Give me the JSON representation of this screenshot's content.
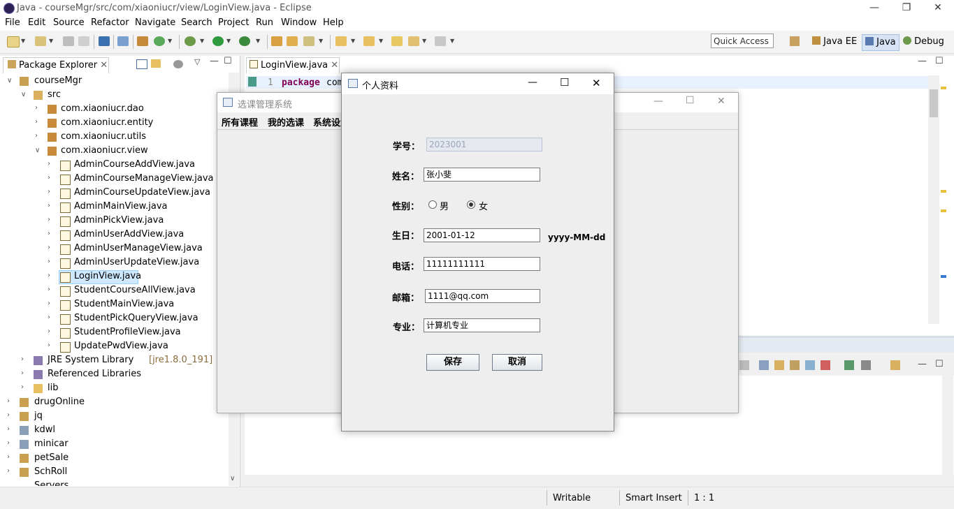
{
  "window": {
    "title": "Java - courseMgr/src/com/xiaoniucr/view/LoginView.java - Eclipse"
  },
  "menu": [
    "File",
    "Edit",
    "Source",
    "Refactor",
    "Navigate",
    "Search",
    "Project",
    "Run",
    "Window",
    "Help"
  ],
  "quick_access": "Quick Access",
  "perspectives": [
    "Java EE",
    "Java",
    "Debug"
  ],
  "package_explorer": {
    "tab": "Package Explorer",
    "project": "courseMgr",
    "src": "src",
    "packages": [
      "com.xiaoniucr.dao",
      "com.xiaoniucr.entity",
      "com.xiaoniucr.utils",
      "com.xiaoniucr.view"
    ],
    "files": [
      "AdminCourseAddView.java",
      "AdminCourseManageView.java",
      "AdminCourseUpdateView.java",
      "AdminMainView.java",
      "AdminPickView.java",
      "AdminUserAddView.java",
      "AdminUserManageView.java",
      "AdminUserUpdateView.java",
      "LoginView.java",
      "StudentCourseAllView.java",
      "StudentMainView.java",
      "StudentPickQueryView.java",
      "StudentProfileView.java",
      "UpdatePwdView.java"
    ],
    "jre": "JRE System Library",
    "jre_version": "[jre1.8.0_191]",
    "ref_libs": "Referenced Libraries",
    "lib": "lib",
    "projects": [
      "drugOnline",
      "jq",
      "kdwl",
      "minicar",
      "petSale",
      "SchRoll",
      "Servers"
    ]
  },
  "editor": {
    "tab": "LoginView.java",
    "line_number": "1",
    "keyword": "package",
    "code_rest": "com"
  },
  "status": {
    "writable": "Writable",
    "insert": "Smart Insert",
    "position": "1 : 1"
  },
  "main_window": {
    "title": "选课管理系统",
    "menus": [
      "所有课程",
      "我的选课",
      "系统设置"
    ]
  },
  "dialog": {
    "title": "个人资料",
    "fields": {
      "id_label": "学号：",
      "id_value": "2023001",
      "name_label": "姓名：",
      "name_value": "张小斐",
      "gender_label": "性别：",
      "male": "男",
      "female": "女",
      "birthday_label": "生日：",
      "birthday_value": "2001-01-12",
      "birthday_hint": "yyyy-MM-dd",
      "phone_label": "电话：",
      "phone_value": "11111111111",
      "email_label": "邮箱：",
      "email_value": "1111@qq.com",
      "major_label": "专业：",
      "major_value": "计算机专业"
    },
    "save": "保存",
    "cancel": "取消"
  }
}
